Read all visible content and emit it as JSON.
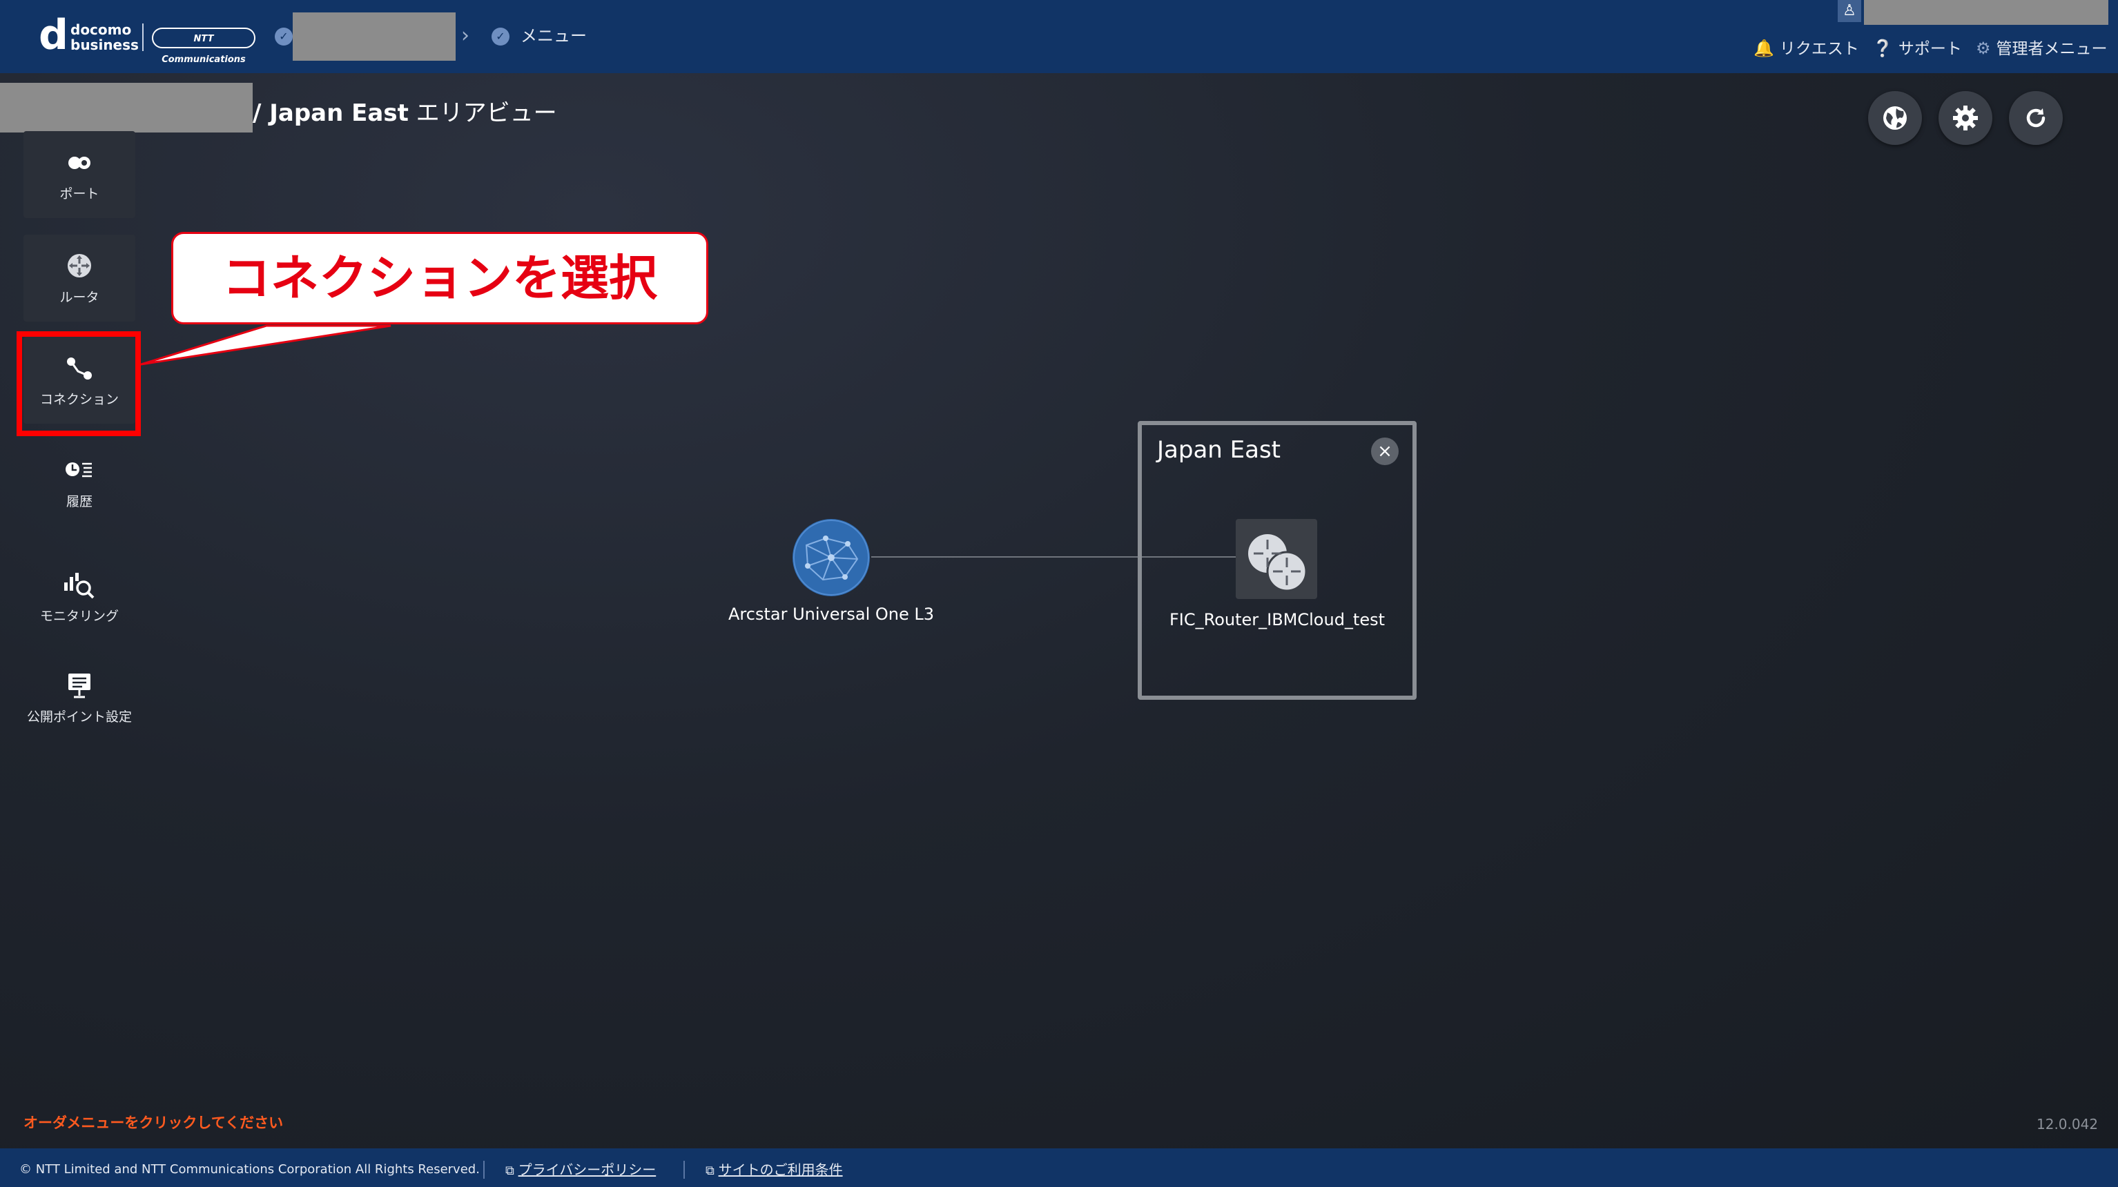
{
  "header": {
    "logo_docomo": "docomo",
    "logo_business": "business",
    "logo_ntt": "NTT Communications",
    "menu_label": "メニュー",
    "links": [
      {
        "label": "リクエスト",
        "icon": "bell-icon"
      },
      {
        "label": "サポート",
        "icon": "help-icon"
      },
      {
        "label": "管理者メニュー",
        "icon": "gear-icon"
      }
    ]
  },
  "breadcrumb": {
    "area": "/ Japan East",
    "view": "エリアビュー"
  },
  "toolbar": {
    "buttons": [
      {
        "name": "globe-button",
        "icon": "globe-icon"
      },
      {
        "name": "settings-button",
        "icon": "gear-icon"
      },
      {
        "name": "refresh-button",
        "icon": "refresh-icon"
      }
    ]
  },
  "sidebar": {
    "items": [
      {
        "label": "ポート",
        "icon": "port-icon"
      },
      {
        "label": "ルータ",
        "icon": "router-icon"
      },
      {
        "label": "コネクション",
        "icon": "connection-icon"
      },
      {
        "label": "履歴",
        "icon": "history-icon"
      },
      {
        "label": "モニタリング",
        "icon": "monitoring-icon"
      },
      {
        "label": "公開ポイント設定",
        "icon": "public-point-icon"
      }
    ]
  },
  "callout": {
    "text": "コネクションを選択"
  },
  "topology": {
    "external_node": "Arcstar Universal One L3",
    "region_title": "Japan East",
    "router_node": "FIC_Router_IBMCloud_test"
  },
  "order_hint": "オーダメニューをクリックしてください",
  "version": "12.0.042",
  "footer": {
    "copyright": "© NTT Limited and NTT Communications Corporation All Rights Reserved.",
    "privacy": "プライバシーポリシー",
    "terms": "サイトのご利用条件"
  },
  "colors": {
    "header": "#113466",
    "highlight": "#ff0000",
    "callout_text": "#e60012",
    "hint": "#ff5a1f",
    "globe": "#2f6bb0"
  }
}
